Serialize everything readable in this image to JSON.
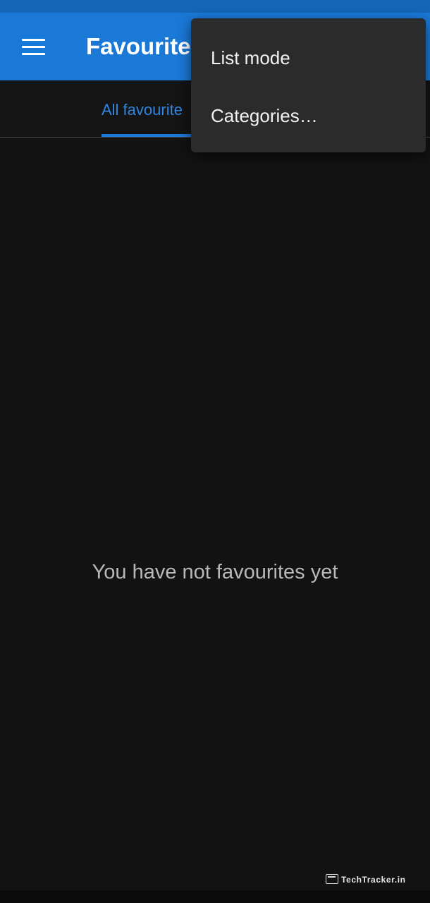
{
  "app_bar": {
    "title": "Favourite",
    "menu_icon": "hamburger-menu-icon"
  },
  "tabs": [
    {
      "label": "All favourite",
      "selected": true
    }
  ],
  "empty_state": {
    "message": "You have not favourites yet"
  },
  "overflow_menu": {
    "items": [
      {
        "label": "List mode"
      },
      {
        "label": "Categories…"
      }
    ]
  },
  "watermark": {
    "text": "TechTracker.in",
    "icon": "browser-window-icon"
  },
  "colors": {
    "primary": "#1a78d6",
    "status_bar": "#1566b8",
    "background": "#121212",
    "menu_background": "#2b2b2b",
    "tab_accent": "#2f86e0"
  }
}
